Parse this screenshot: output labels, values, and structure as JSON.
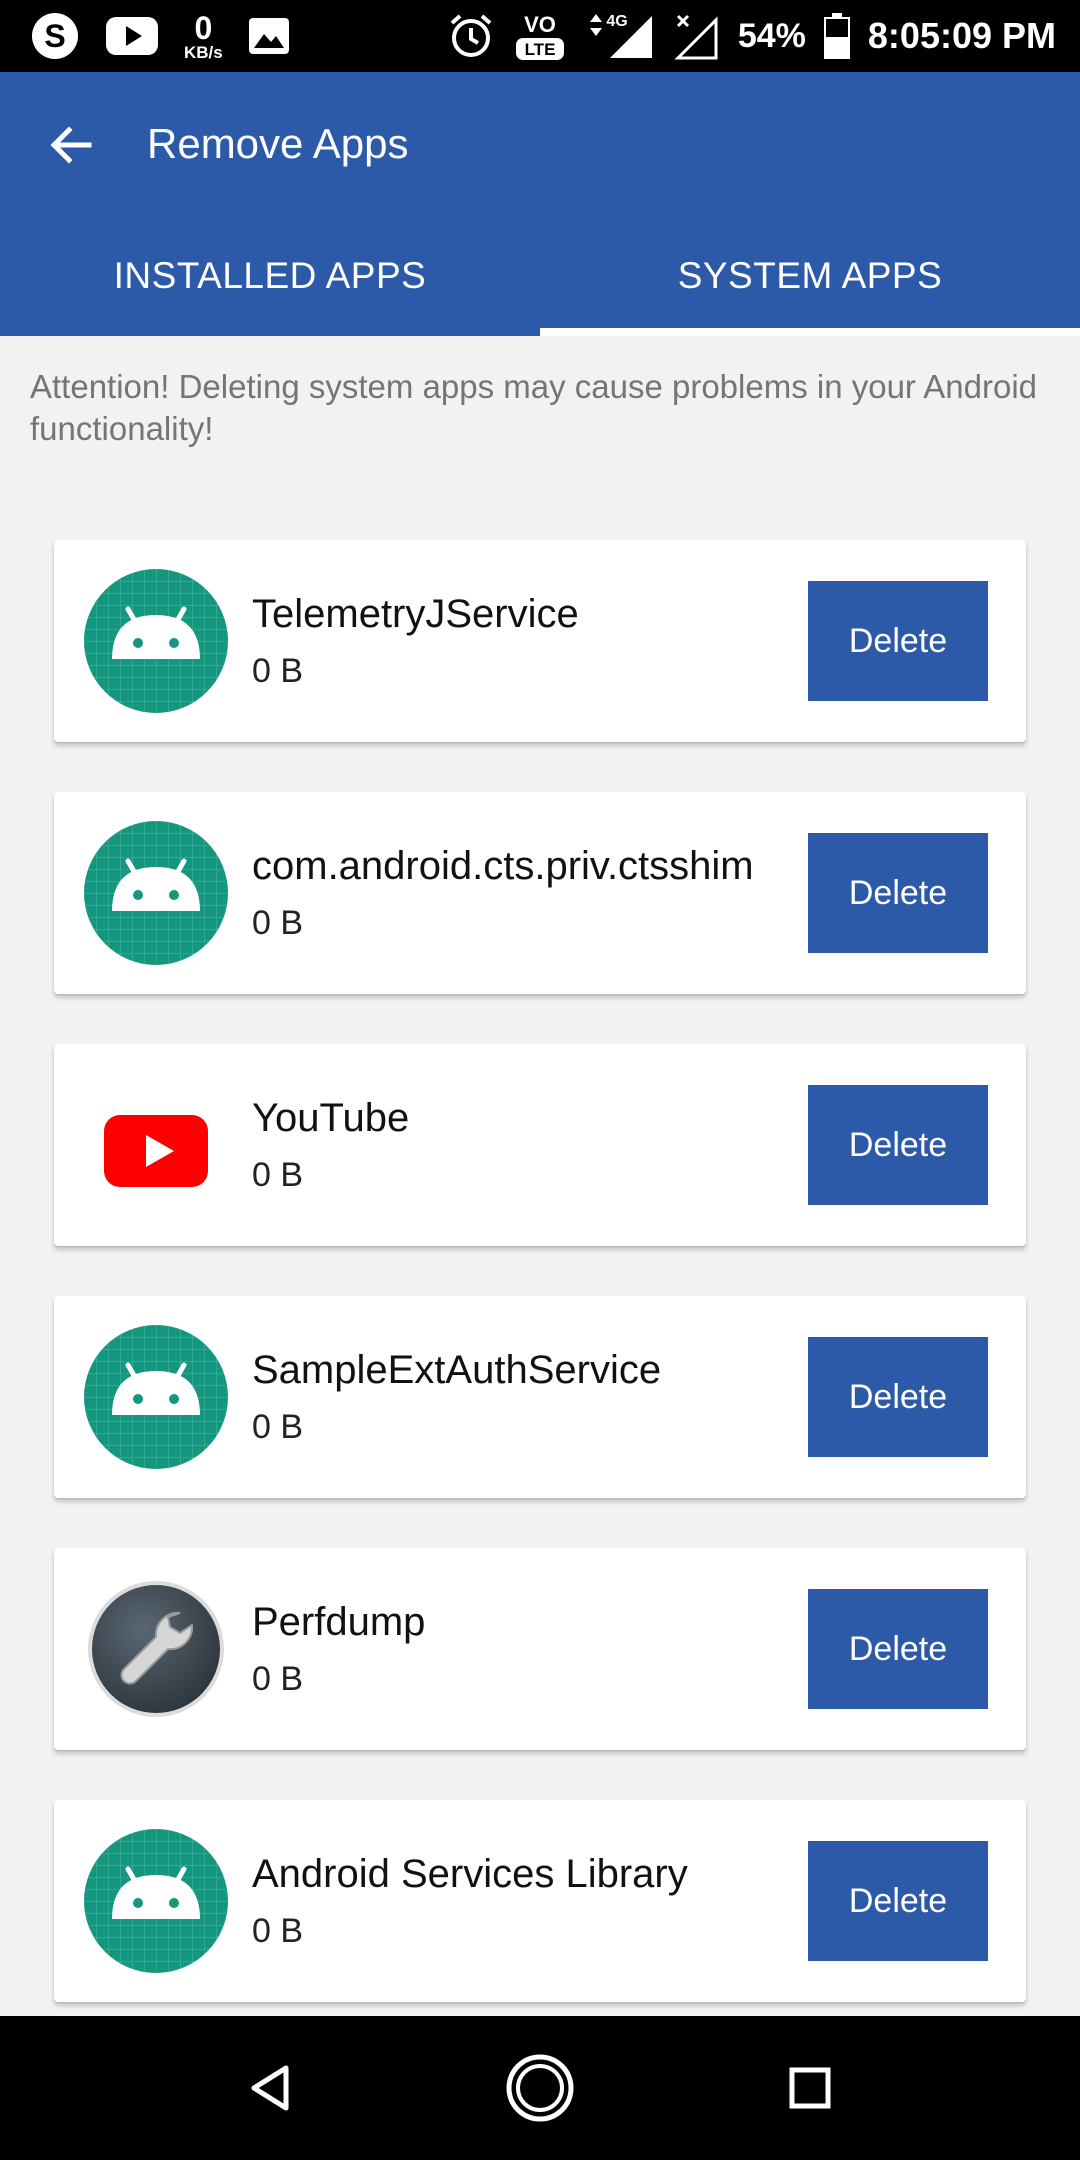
{
  "status_bar": {
    "left_icons": [
      "skype-icon",
      "youtube-icon",
      "data-speed",
      "gallery-icon"
    ],
    "data_speed_value": "0",
    "data_speed_unit": "KB/s",
    "battery_percent": "54%",
    "time": "8:05:09 PM",
    "network_label": "4G",
    "volte_label": "VO",
    "lte_label": "LTE"
  },
  "app_bar": {
    "title": "Remove Apps",
    "back_icon": "arrow-left-icon"
  },
  "tabs": [
    {
      "label": "INSTALLED APPS",
      "active": false
    },
    {
      "label": "SYSTEM APPS",
      "active": true
    }
  ],
  "attention_text": "Attention! Deleting system apps may cause problems in your Android functionality!",
  "apps": [
    {
      "name": "TelemetryJService",
      "size": "0 B",
      "icon": "android-icon",
      "action": "Delete"
    },
    {
      "name": "com.android.cts.priv.ctsshim",
      "size": "0 B",
      "icon": "android-icon",
      "action": "Delete"
    },
    {
      "name": "YouTube",
      "size": "0 B",
      "icon": "youtube-icon",
      "action": "Delete"
    },
    {
      "name": "SampleExtAuthService",
      "size": "0 B",
      "icon": "android-icon",
      "action": "Delete"
    },
    {
      "name": "Perfdump",
      "size": "0 B",
      "icon": "wrench-icon",
      "action": "Delete"
    },
    {
      "name": "Android Services Library",
      "size": "0 B",
      "icon": "android-icon",
      "action": "Delete"
    }
  ],
  "nav_bar": {
    "buttons": [
      "back-triangle-icon",
      "home-circle-icon",
      "recents-square-icon"
    ]
  },
  "colors": {
    "primary": "#2d5aa8",
    "android_icon_bg": "#14967f",
    "youtube_red": "#ff0000"
  }
}
